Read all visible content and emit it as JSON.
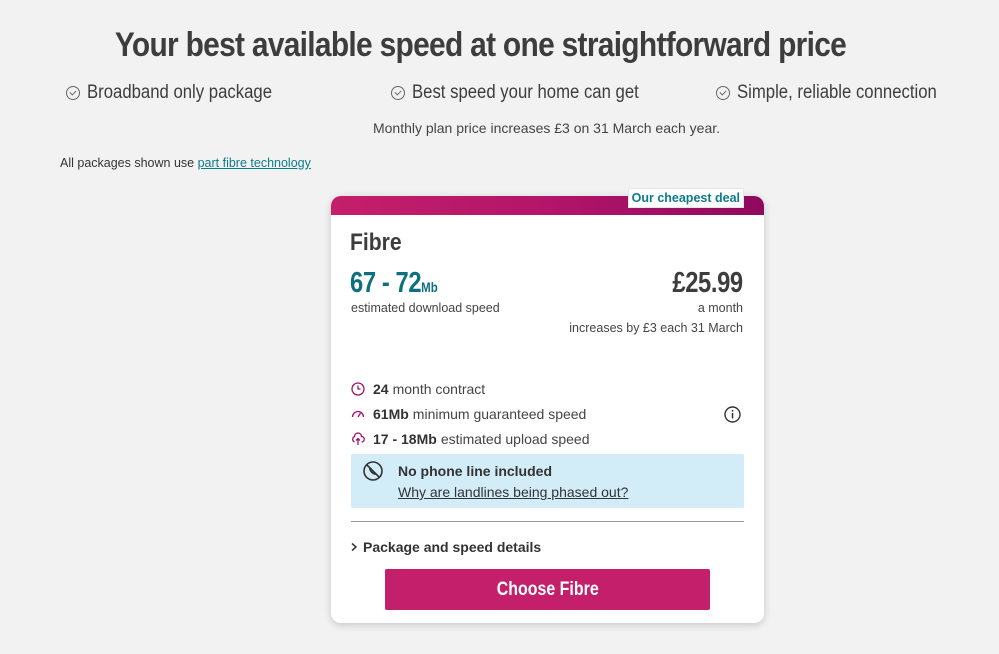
{
  "headline": "Your best available speed at one straightforward price",
  "features": [
    "Broadband only package",
    "Best speed your home can get",
    "Simple, reliable connection"
  ],
  "price_notice": "Monthly plan price increases £3 on 31 March each year.",
  "disclaimer": {
    "prefix": "All packages shown use ",
    "link": "part fibre technology"
  },
  "card": {
    "badge": "Our cheapest deal",
    "title": "Fibre",
    "speed_range": "67 - 72",
    "speed_unit": "Mb",
    "speed_label": "estimated download speed",
    "price": "£25.99",
    "price_period": "a month",
    "price_increase": "increases by £3 each 31 March",
    "specs": [
      {
        "bold": "24",
        "text": "month contract",
        "icon": "clock-icon"
      },
      {
        "bold": "61Mb",
        "text": "minimum guaranteed speed",
        "icon": "speedometer-icon"
      },
      {
        "bold": "17 - 18Mb",
        "text": "estimated upload speed",
        "icon": "cloud-upload-icon"
      }
    ],
    "phone_title": "No phone line included",
    "phone_link": "Why are landlines being phased out?",
    "details_label": "Package and speed details",
    "cta_label": "Choose Fibre"
  },
  "colors": {
    "brand": "#c41f6a",
    "accent_teal": "#0e7a8a",
    "info_box": "#d2ecf8"
  }
}
